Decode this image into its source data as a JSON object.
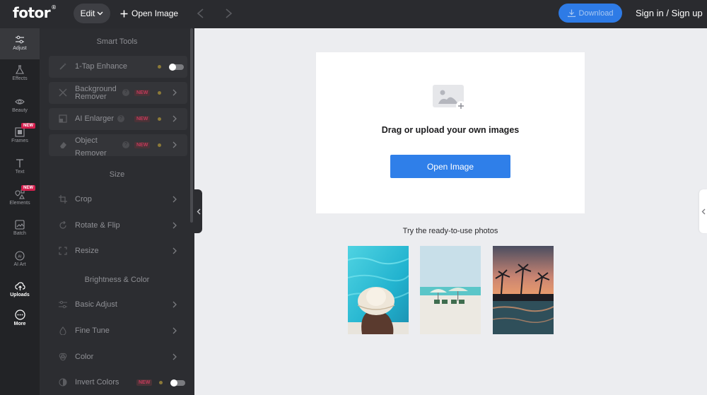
{
  "topbar": {
    "logo_text": "fotor",
    "logo_mark": "®",
    "edit_label": "Edit",
    "open_image_label": "Open Image",
    "download_label": "Download",
    "signin_label": "Sign in / Sign up"
  },
  "rail": {
    "items": [
      {
        "label": "Adjust",
        "icon": "sliders-icon"
      },
      {
        "label": "Effects",
        "icon": "flask-icon"
      },
      {
        "label": "Beauty",
        "icon": "eye-icon"
      },
      {
        "label": "Frames",
        "icon": "frame-icon",
        "badge": "NEW"
      },
      {
        "label": "Text",
        "icon": "text-icon"
      },
      {
        "label": "Elements",
        "icon": "shapes-icon",
        "badge": "NEW"
      },
      {
        "label": "Batch",
        "icon": "batch-icon"
      },
      {
        "label": "AI Art",
        "icon": "ai-icon"
      },
      {
        "label": "Uploads",
        "icon": "cloud-upload-icon"
      },
      {
        "label": "More",
        "icon": "more-icon"
      }
    ]
  },
  "panel": {
    "smart_tools_title": "Smart Tools",
    "size_title": "Size",
    "brightness_title": "Brightness & Color",
    "tools": {
      "one_tap": "1-Tap Enhance",
      "bg_remover": "Background Remover",
      "ai_enlarger": "AI Enlarger",
      "object_remover": "Object Remover",
      "crop": "Crop",
      "rotate": "Rotate & Flip",
      "resize": "Resize",
      "basic_adjust": "Basic Adjust",
      "fine_tune": "Fine Tune",
      "color": "Color",
      "invert": "Invert Colors"
    },
    "new_badge": "NEW",
    "info_mark": "?"
  },
  "canvas": {
    "upload_text": "Drag or upload your own images",
    "open_button": "Open Image",
    "try_text": "Try the ready-to-use photos"
  },
  "colors": {
    "accent": "#2f7fe9",
    "topbar": "#2a2b2f",
    "panel": "#2c2d31",
    "new_badge": "#d5204f"
  }
}
